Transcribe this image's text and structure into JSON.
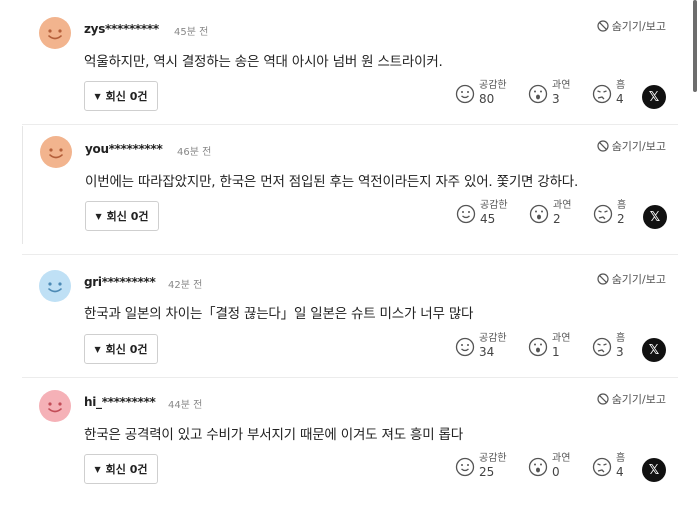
{
  "ui": {
    "hide_label": "숨기기/보고",
    "reply_label": "회신 0건",
    "reactions": {
      "empathy": "공감한",
      "overdo": "과연",
      "hmm": "흠"
    },
    "x_label": "𝕏"
  },
  "colors": {
    "avatar_orange": "#f2b48e",
    "avatar_blue": "#bfe0f5",
    "avatar_pink": "#f5b1b7"
  },
  "comments": [
    {
      "user": "zys*********",
      "time": "45분 전",
      "text": "억울하지만, 역시 결정하는 송은 역대 아시아 넘버 원 스트라이커.",
      "avatar": "orange",
      "counts": {
        "empathy": "80",
        "overdo": "3",
        "hmm": "4"
      }
    },
    {
      "user": "you*********",
      "time": "46분 전",
      "text": "이번에는 따라잡았지만, 한국은 먼저 점입된 후는 역전이라든지 자주 있어. 쫓기면 강하다.",
      "avatar": "orange",
      "counts": {
        "empathy": "45",
        "overdo": "2",
        "hmm": "2"
      }
    },
    {
      "user": "gri*********",
      "time": "42분 전",
      "text": "한국과 일본의 차이는「결정 끊는다」일 일본은 슈트 미스가 너무 많다",
      "avatar": "blue",
      "counts": {
        "empathy": "34",
        "overdo": "1",
        "hmm": "3"
      }
    },
    {
      "user": "hi_*********",
      "time": "44분 전",
      "text": "한국은 공격력이 있고 수비가 부서지기 때문에 이겨도 져도 흥미 롭다",
      "avatar": "pink",
      "counts": {
        "empathy": "25",
        "overdo": "0",
        "hmm": "4"
      }
    }
  ]
}
